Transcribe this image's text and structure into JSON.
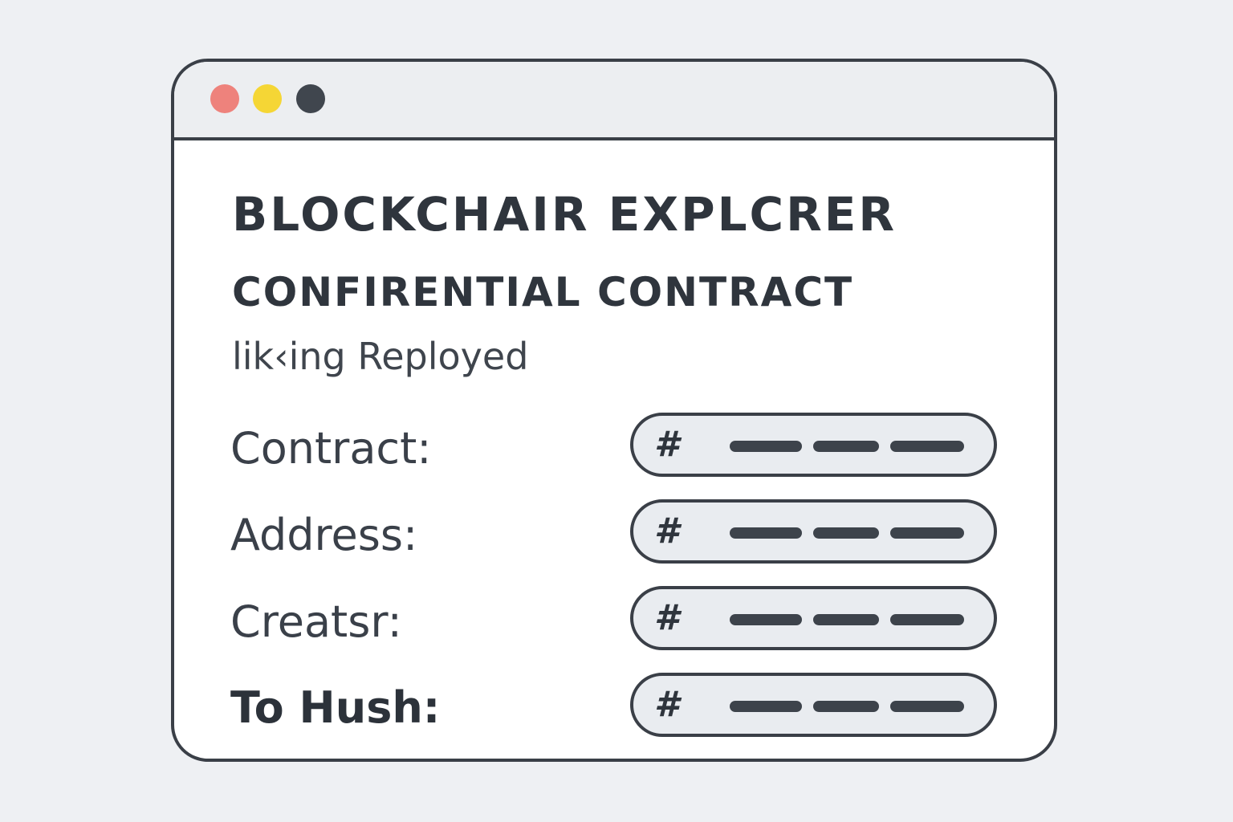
{
  "window": {
    "controls": [
      {
        "name": "close",
        "color": "#ee827c"
      },
      {
        "name": "minimize",
        "color": "#f5d635"
      },
      {
        "name": "menu",
        "color": "#40464e"
      }
    ]
  },
  "main": {
    "title": "BLOCKCHAIR EXPLCRER",
    "subtitle": "CONFIRENTIAL CONTRACT",
    "status": "lik‹ing Reployed",
    "fields": [
      {
        "label": "Contract:",
        "icon": "hash-icon",
        "value_masked": true
      },
      {
        "label": "Address:",
        "icon": "hash-icon",
        "value_masked": true
      },
      {
        "label": "Creatsr:",
        "icon": "hash-icon",
        "value_masked": true
      },
      {
        "label": "To Hush:",
        "icon": "hash-icon",
        "value_masked": true
      }
    ]
  }
}
